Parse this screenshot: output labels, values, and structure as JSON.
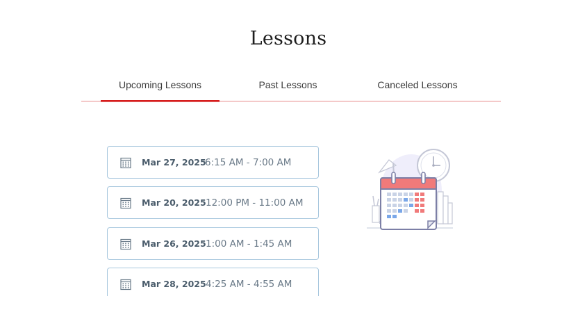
{
  "page": {
    "title": "Lessons"
  },
  "tabs": [
    {
      "label": "Upcoming Lessons",
      "active": true
    },
    {
      "label": "Past Lessons",
      "active": false
    },
    {
      "label": "Canceled Lessons",
      "active": false
    }
  ],
  "lessons": [
    {
      "date": "Mar 27, 2025",
      "time": "6:15 AM - 7:00 AM"
    },
    {
      "date": "Mar 20, 2025",
      "time": "12:00 PM - 11:00 AM"
    },
    {
      "date": "Mar 26, 2025",
      "time": "1:00 AM - 1:45 AM"
    },
    {
      "date": "Mar 28, 2025",
      "time": "4:25 AM - 4:55 AM"
    }
  ],
  "colors": {
    "accent": "#d41010",
    "tab_underline": "#e88a8a",
    "card_border": "#a7c7de",
    "calendar_header": "#f07a7a"
  },
  "icons": {
    "lesson": "calendar-icon",
    "illustration": "calendar-clock-illustration"
  }
}
